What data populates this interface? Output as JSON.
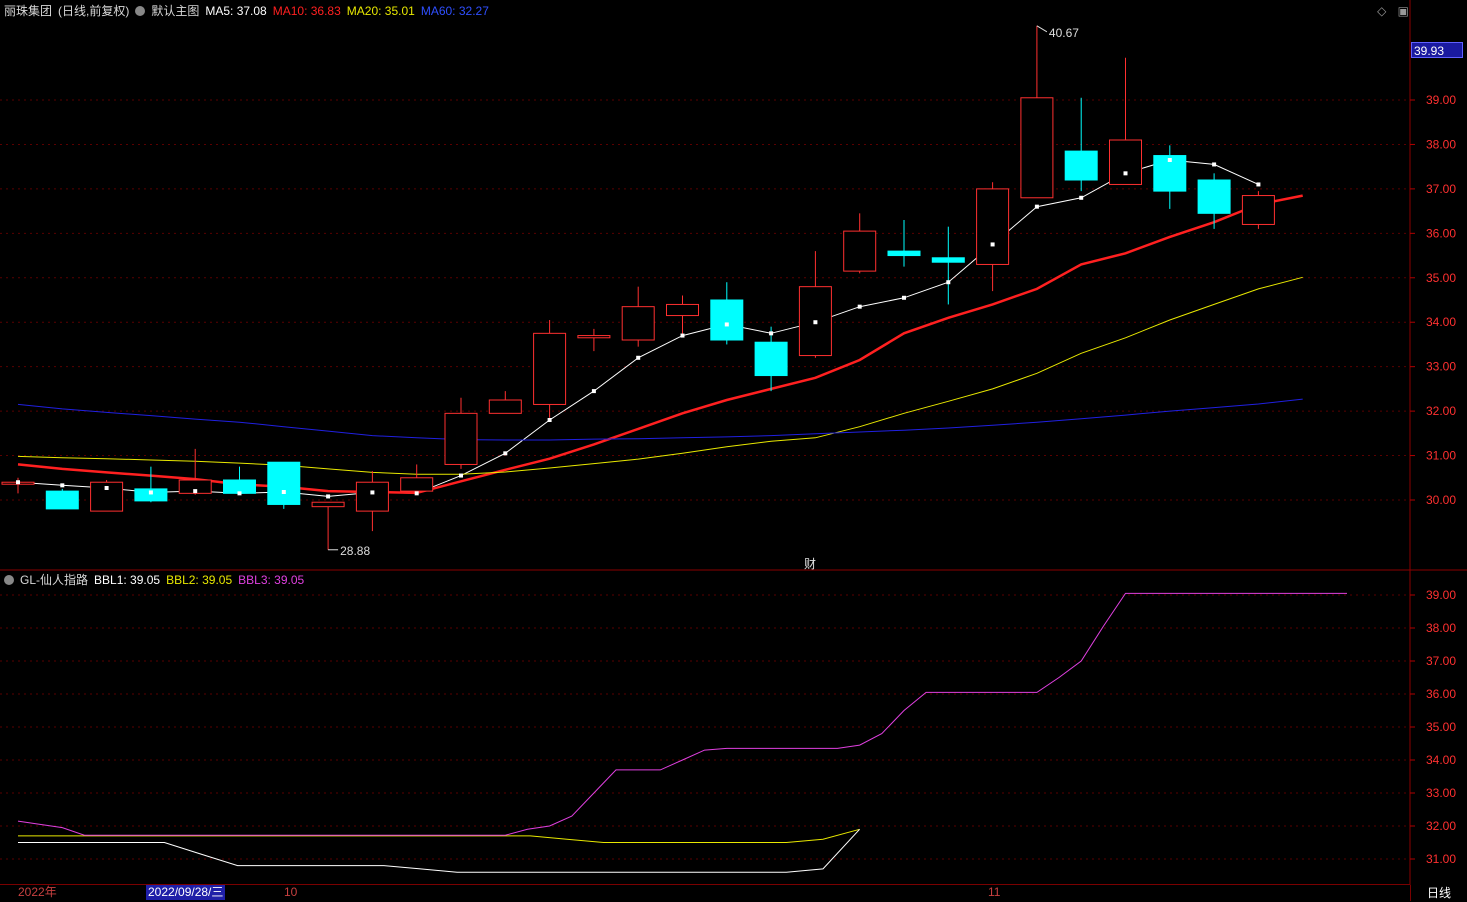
{
  "header": {
    "stock": "丽珠集团",
    "mode": "(日线,前复权)",
    "template": "默认主图",
    "ma5_label": "MA5: 37.08",
    "ma10_label": "MA10: 36.83",
    "ma20_label": "MA20: 35.01",
    "ma60_label": "MA60: 32.27",
    "ma_colors": {
      "ma5": "#ffffff",
      "ma10": "#ff2020",
      "ma20": "#e8e800",
      "ma60": "#2020e0"
    }
  },
  "indicator_header": {
    "name": "GL-仙人指路",
    "bbl1_label": "BBL1: 39.05",
    "bbl2_label": "BBL2: 39.05",
    "bbl3_label": "BBL3: 39.05",
    "colors": {
      "bbl1": "#ffffff",
      "bbl2": "#e8e800",
      "bbl3": "#e040e0"
    }
  },
  "top_icons": [
    "diamond-icon",
    "window-icon"
  ],
  "current_price_tag": "39.93",
  "finance_marker": "财",
  "bottom_axis": {
    "year_label": "2022年",
    "selected_date": "2022/09/28/三",
    "month_labels": [
      "10",
      "11"
    ]
  },
  "period_label": "日线",
  "colors": {
    "up": "#ff3030",
    "down": "#00ffff",
    "axis": "#b00000",
    "label": "#ff3030"
  },
  "chart_data": [
    {
      "type": "candlestick",
      "title": "丽珠集团 (日线,前复权)",
      "ylim": [
        28.6,
        41.0
      ],
      "yticks": [
        30.0,
        31.0,
        32.0,
        33.0,
        34.0,
        35.0,
        36.0,
        37.0,
        38.0,
        39.0
      ],
      "ytick_labels": [
        "30.00",
        "31.00",
        "32.00",
        "33.00",
        "34.00",
        "35.00",
        "36.00",
        "37.00",
        "38.00",
        "39.00"
      ],
      "annotations": [
        {
          "text": "40.67",
          "value": 40.67
        },
        {
          "text": "28.88",
          "value": 28.88
        }
      ],
      "candles": [
        {
          "o": 30.4,
          "h": 30.5,
          "l": 30.15,
          "c": 30.4
        },
        {
          "o": 30.2,
          "h": 30.25,
          "l": 29.8,
          "c": 29.8
        },
        {
          "o": 29.75,
          "h": 30.45,
          "l": 29.75,
          "c": 30.4
        },
        {
          "o": 30.25,
          "h": 30.75,
          "l": 29.95,
          "c": 29.98
        },
        {
          "o": 30.15,
          "h": 31.15,
          "l": 30.12,
          "c": 30.45
        },
        {
          "o": 30.45,
          "h": 30.75,
          "l": 30.15,
          "c": 30.15
        },
        {
          "o": 30.85,
          "h": 30.85,
          "l": 29.8,
          "c": 29.9
        },
        {
          "o": 29.85,
          "h": 29.95,
          "l": 28.88,
          "c": 29.95
        },
        {
          "o": 29.75,
          "h": 30.65,
          "l": 29.3,
          "c": 30.4
        },
        {
          "o": 30.2,
          "h": 30.8,
          "l": 30.15,
          "c": 30.5
        },
        {
          "o": 30.8,
          "h": 32.3,
          "l": 30.7,
          "c": 31.95
        },
        {
          "o": 31.95,
          "h": 32.45,
          "l": 31.95,
          "c": 32.25
        },
        {
          "o": 32.15,
          "h": 34.05,
          "l": 31.85,
          "c": 33.75
        },
        {
          "o": 33.65,
          "h": 33.85,
          "l": 33.35,
          "c": 33.7
        },
        {
          "o": 33.6,
          "h": 34.8,
          "l": 33.45,
          "c": 34.35
        },
        {
          "o": 34.15,
          "h": 34.6,
          "l": 33.7,
          "c": 34.4
        },
        {
          "o": 34.5,
          "h": 34.9,
          "l": 33.5,
          "c": 33.6
        },
        {
          "o": 33.55,
          "h": 33.9,
          "l": 32.45,
          "c": 32.8
        },
        {
          "o": 33.25,
          "h": 35.6,
          "l": 33.2,
          "c": 34.8
        },
        {
          "o": 35.15,
          "h": 36.45,
          "l": 35.1,
          "c": 36.05
        },
        {
          "o": 35.6,
          "h": 36.3,
          "l": 35.25,
          "c": 35.5
        },
        {
          "o": 35.45,
          "h": 36.15,
          "l": 34.4,
          "c": 35.35
        },
        {
          "o": 35.3,
          "h": 37.15,
          "l": 34.7,
          "c": 37.0
        },
        {
          "o": 36.8,
          "h": 40.67,
          "l": 36.8,
          "c": 39.05
        },
        {
          "o": 37.85,
          "h": 39.05,
          "l": 36.95,
          "c": 37.2
        },
        {
          "o": 37.1,
          "h": 39.95,
          "l": 37.1,
          "c": 38.1
        },
        {
          "o": 37.75,
          "h": 37.98,
          "l": 36.55,
          "c": 36.95
        },
        {
          "o": 37.2,
          "h": 37.35,
          "l": 36.1,
          "c": 36.45
        },
        {
          "o": 36.2,
          "h": 36.95,
          "l": 36.1,
          "c": 36.85
        }
      ],
      "series": [
        {
          "name": "MA5",
          "color": "#ffffff",
          "marker": "square",
          "values": [
            30.4,
            30.33,
            30.27,
            30.17,
            30.2,
            30.15,
            30.18,
            30.08,
            30.17,
            30.15,
            30.55,
            31.05,
            31.8,
            32.45,
            33.2,
            33.7,
            33.95,
            33.75,
            34.0,
            34.35,
            34.55,
            34.9,
            35.75,
            36.6,
            36.8,
            37.35,
            37.65,
            37.55,
            37.1
          ]
        },
        {
          "name": "MA10",
          "color": "#ff2020",
          "values": [
            30.8,
            30.7,
            30.62,
            30.55,
            30.47,
            30.35,
            30.3,
            30.2,
            30.18,
            30.16,
            30.42,
            30.68,
            30.93,
            31.25,
            31.6,
            31.95,
            32.25,
            32.5,
            32.75,
            33.15,
            33.75,
            34.1,
            34.4,
            34.75,
            35.3,
            35.55,
            35.92,
            36.25,
            36.65,
            36.85
          ]
        },
        {
          "name": "MA20",
          "color": "#e8e800",
          "values": [
            30.98,
            30.95,
            30.93,
            30.9,
            30.87,
            30.83,
            30.78,
            30.7,
            30.62,
            30.58,
            30.58,
            30.63,
            30.72,
            30.82,
            30.92,
            31.05,
            31.2,
            31.32,
            31.4,
            31.65,
            31.95,
            32.22,
            32.5,
            32.85,
            33.3,
            33.65,
            34.05,
            34.4,
            34.75,
            35.01
          ]
        },
        {
          "name": "MA60",
          "color": "#2020e0",
          "values": [
            32.15,
            32.05,
            31.97,
            31.9,
            31.82,
            31.75,
            31.65,
            31.55,
            31.45,
            31.4,
            31.36,
            31.35,
            31.35,
            31.37,
            31.38,
            31.4,
            31.42,
            31.45,
            31.49,
            31.53,
            31.57,
            31.62,
            31.68,
            31.75,
            31.83,
            31.91,
            32.0,
            32.08,
            32.16,
            32.27
          ]
        }
      ]
    },
    {
      "type": "line",
      "title": "GL-仙人指路",
      "ylim": [
        30.6,
        39.4
      ],
      "yticks": [
        31.0,
        32.0,
        33.0,
        34.0,
        35.0,
        36.0,
        37.0,
        38.0,
        39.0
      ],
      "ytick_labels": [
        "31.00",
        "32.00",
        "33.00",
        "34.00",
        "35.00",
        "36.00",
        "37.00",
        "38.00",
        "39.00"
      ],
      "series": [
        {
          "name": "BBL1",
          "color": "#ffffff",
          "values": [
            31.5,
            31.5,
            31.5,
            31.5,
            31.5,
            31.15,
            30.8,
            30.8,
            30.8,
            30.8,
            30.8,
            30.7,
            30.6,
            30.6,
            30.6,
            30.6,
            30.6,
            30.6,
            30.6,
            30.6,
            30.6,
            30.6,
            30.7,
            31.9
          ]
        },
        {
          "name": "BBL2",
          "color": "#e8e800",
          "values": [
            null,
            null,
            null,
            null,
            null,
            null,
            null,
            null,
            null,
            null,
            null,
            null,
            null,
            null,
            null,
            null,
            null,
            null,
            null,
            null,
            null,
            null,
            31.6,
            31.9
          ],
          "values_full": [
            31.7,
            31.7,
            31.7,
            31.7,
            31.7,
            31.7,
            31.7,
            31.7,
            31.7,
            31.7,
            31.7,
            31.7,
            31.7,
            31.7,
            31.7,
            31.6,
            31.5,
            31.5,
            31.5,
            31.5,
            31.5,
            31.5,
            31.6,
            31.9
          ]
        },
        {
          "name": "BBL3",
          "color": "#e040e0",
          "values": [
            32.15,
            32.05,
            31.95,
            31.72,
            31.72,
            31.72,
            31.72,
            31.72,
            31.72,
            31.72,
            31.72,
            31.72,
            31.72,
            31.72,
            31.72,
            31.72,
            31.72,
            31.72,
            31.72,
            31.72,
            31.72,
            31.72,
            31.72,
            31.9,
            32.0,
            32.3,
            33.0,
            33.7,
            33.7,
            33.7,
            34.0,
            34.3,
            34.35,
            34.35,
            34.35,
            34.35,
            34.35,
            34.35,
            34.45,
            34.8,
            35.5,
            36.05,
            36.05,
            36.05,
            36.05,
            36.05,
            36.05,
            36.5,
            37.0,
            38.05,
            39.05,
            39.05,
            39.05,
            39.05,
            39.05,
            39.05,
            39.05,
            39.05,
            39.05,
            39.05,
            39.05
          ]
        }
      ]
    }
  ]
}
